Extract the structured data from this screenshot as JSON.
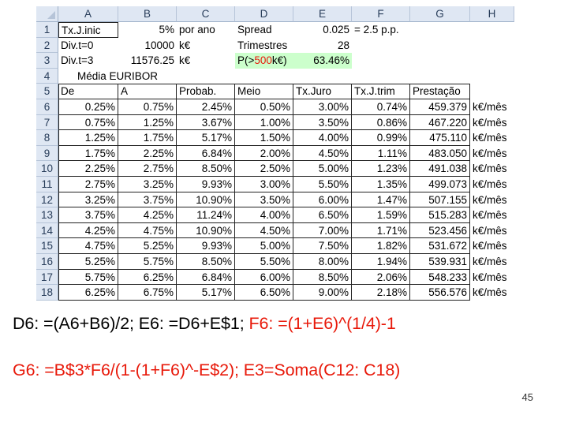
{
  "spreadsheet": {
    "columns": [
      "A",
      "B",
      "C",
      "D",
      "E",
      "F",
      "G",
      "H"
    ],
    "rows": [
      "1",
      "2",
      "3",
      "4",
      "5",
      "6",
      "7",
      "8",
      "9",
      "10",
      "11",
      "12",
      "13",
      "14",
      "15",
      "16",
      "17",
      "18"
    ],
    "top": {
      "a1": "Tx.J.inic",
      "b1": "5%",
      "c1": "por ano",
      "d1": "Spread",
      "e1": "0.025",
      "f1": "= 2.5 p.p.",
      "a2": "Div.t=0",
      "b2": "10000",
      "c2": "k€",
      "d2": "Trimestres",
      "e2": "28",
      "a3": "Div.t=3",
      "b3": "11576.25",
      "c3": "k€",
      "d3_pre": "P(>",
      "d3_red": "500",
      "d3_post": "k€)",
      "e3": "63.46%",
      "a4": "Média EURIBOR"
    },
    "headers": {
      "de": "De",
      "a": "A",
      "probab": "Probab.",
      "meio": "Meio",
      "txjuro": "Tx.Juro",
      "txjtrim": "Tx.J.trim",
      "prestacao": "Prestação"
    },
    "unit": "k€/mês",
    "table": [
      [
        "0.25%",
        "0.75%",
        "2.45%",
        "0.50%",
        "3.00%",
        "0.74%",
        "459.379"
      ],
      [
        "0.75%",
        "1.25%",
        "3.67%",
        "1.00%",
        "3.50%",
        "0.86%",
        "467.220"
      ],
      [
        "1.25%",
        "1.75%",
        "5.17%",
        "1.50%",
        "4.00%",
        "0.99%",
        "475.110"
      ],
      [
        "1.75%",
        "2.25%",
        "6.84%",
        "2.00%",
        "4.50%",
        "1.11%",
        "483.050"
      ],
      [
        "2.25%",
        "2.75%",
        "8.50%",
        "2.50%",
        "5.00%",
        "1.23%",
        "491.038"
      ],
      [
        "2.75%",
        "3.25%",
        "9.93%",
        "3.00%",
        "5.50%",
        "1.35%",
        "499.073"
      ],
      [
        "3.25%",
        "3.75%",
        "10.90%",
        "3.50%",
        "6.00%",
        "1.47%",
        "507.155"
      ],
      [
        "3.75%",
        "4.25%",
        "11.24%",
        "4.00%",
        "6.50%",
        "1.59%",
        "515.283"
      ],
      [
        "4.25%",
        "4.75%",
        "10.90%",
        "4.50%",
        "7.00%",
        "1.71%",
        "523.456"
      ],
      [
        "4.75%",
        "5.25%",
        "9.93%",
        "5.00%",
        "7.50%",
        "1.82%",
        "531.672"
      ],
      [
        "5.25%",
        "5.75%",
        "8.50%",
        "5.50%",
        "8.00%",
        "1.94%",
        "539.931"
      ],
      [
        "5.75%",
        "6.25%",
        "6.84%",
        "6.00%",
        "8.50%",
        "2.06%",
        "548.233"
      ],
      [
        "6.25%",
        "6.75%",
        "5.17%",
        "6.50%",
        "9.00%",
        "2.18%",
        "556.576"
      ]
    ]
  },
  "notes": {
    "line1_black": "D6: =(A6+B6)/2; E6: =D6+E$1; ",
    "line1_red": "F6: =(1+E6)^(1/4)-1",
    "line2_red": "G6: =B$3*F6/(1-(1+F6)^-E$2); E3=Soma(C12: C18)"
  },
  "slide_number": "45",
  "colors": {
    "header_bg": "#dfe7f3",
    "highlight": "#ccffcc",
    "accent_red": "#e8190a"
  }
}
